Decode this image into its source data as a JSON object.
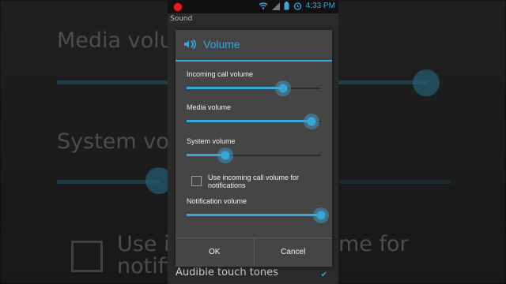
{
  "status_bar": {
    "time": "4:33 PM",
    "icons": [
      "record-icon",
      "wifi-icon",
      "signal-icon",
      "battery-icon",
      "alarm-icon"
    ],
    "accent": "#3ca5d8"
  },
  "app": {
    "title": "Sound",
    "bottom_item": "Audible touch tones"
  },
  "background_zoom": {
    "media_volume": "Media volume",
    "system_volume": "System volu",
    "check_text_left": "Use in",
    "check_text_left2": "notifi",
    "check_text_right": "me for"
  },
  "dialog": {
    "title": "Volume",
    "sliders": [
      {
        "label": "Incoming call volume",
        "level": 0.72
      },
      {
        "label": "Media volume",
        "level": 0.93
      },
      {
        "label": "System volume",
        "level": 0.29
      }
    ],
    "checkbox": {
      "label": "Use incoming call volume for notifications",
      "checked": false
    },
    "notification": {
      "label": "Notification volume",
      "level": 1.0
    },
    "ok": "OK",
    "cancel": "Cancel"
  }
}
